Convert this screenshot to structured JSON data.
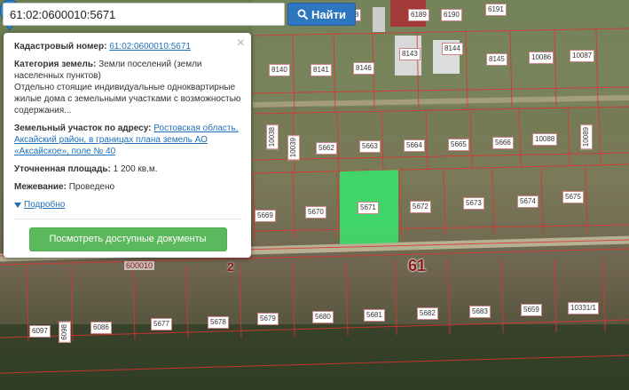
{
  "search": {
    "value": "61:02:0600010:5671",
    "button_label": "Найти"
  },
  "popup": {
    "cadastral_label": "Кадастровый номер:",
    "cadastral_value": "61:02:0600010:5671",
    "category_label": "Категория земель:",
    "category_value": "Земли поселений (земли населенных пунктов)",
    "usage_text": "Отдельно стоящие индивидуальные одноквартирные жилые дома с земельными участками с возможностью содержания...",
    "address_label": "Земельный участок по адресу:",
    "address_value": "Ростовская область, Аксайский район, в границах плана земель АО «Аксайское», поле № 40",
    "area_label": "Уточненная площадь:",
    "area_value": "1 200 кв.м.",
    "survey_label": "Межевание:",
    "survey_value": "Проведено",
    "details_label": "Подробно",
    "documents_button": "Посмотреть доступные документы",
    "close_symbol": "×"
  },
  "map": {
    "quarter_number": "61",
    "street_number": "2",
    "quarter_code": "600010",
    "parcels": [
      "6189",
      "6190",
      "6191",
      "188",
      "8140",
      "8141",
      "8146",
      "8143",
      "8144",
      "8145",
      "10086",
      "10087",
      "5662",
      "5663",
      "5664",
      "5665",
      "5666",
      "10088",
      "10089",
      "10038",
      "10039",
      "5669",
      "5670",
      "5672",
      "5673",
      "5674",
      "5675",
      "5671",
      "6097",
      "6098",
      "6086",
      "5677",
      "5678",
      "5679",
      "5680",
      "5681",
      "5682",
      "5683",
      "5659",
      "10331/1"
    ]
  }
}
